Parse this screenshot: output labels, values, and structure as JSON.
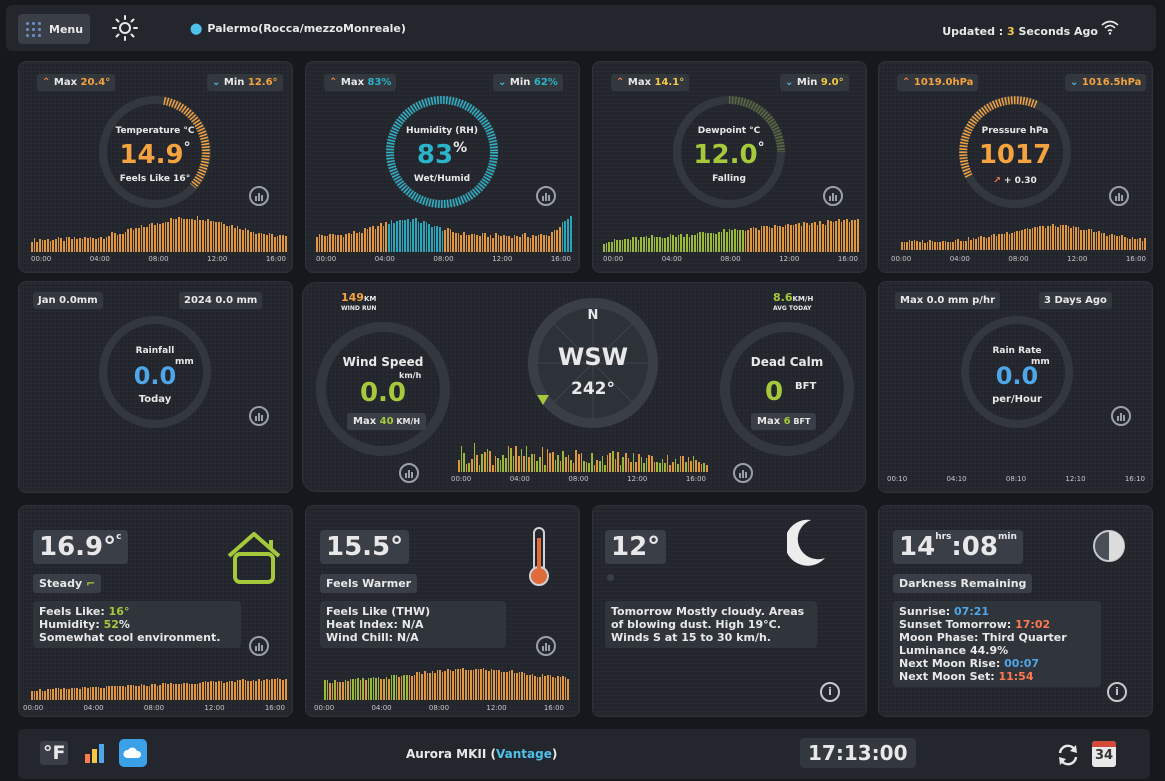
{
  "topbar": {
    "menu_label": "Menu",
    "location": "Palermo(Rocca/mezzoMonreale)",
    "updated_prefix": "Updated : ",
    "updated_count": "3",
    "updated_suffix": " Seconds Ago"
  },
  "temperature": {
    "max_label": "Max",
    "max_value": "20.4°",
    "min_label": "Min",
    "min_value": "12.6°",
    "title": "Temperature °C",
    "value": "14.9",
    "unit": "°",
    "sub": "Feels Like 16°",
    "ticks": [
      "00:00",
      "04:00",
      "08:00",
      "12:00",
      "16:00"
    ]
  },
  "humidity": {
    "max_label": "Max",
    "max_value": "83%",
    "min_label": "Min",
    "min_value": "62%",
    "title": "Humidity (RH)",
    "value": "83",
    "unit": "%",
    "sub": "Wet/Humid",
    "ticks": [
      "00:00",
      "04:00",
      "08:00",
      "12:00",
      "16:00"
    ]
  },
  "dewpoint": {
    "max_label": "Max",
    "max_value": "14.1°",
    "min_label": "Min",
    "min_value": "9.0°",
    "title": "Dewpoint °C",
    "value": "12.0",
    "unit": "°",
    "sub": "Falling",
    "ticks": [
      "00:00",
      "04:00",
      "08:00",
      "12:00",
      "16:00"
    ]
  },
  "pressure": {
    "max_value": "1019.0hPa",
    "min_value": "1016.5hPa",
    "title": "Pressure hPa",
    "value": "1017",
    "trend": "+ 0.30",
    "ticks": [
      "00:00",
      "04:00",
      "08:00",
      "12:00",
      "16:00"
    ]
  },
  "rainfall": {
    "month": "Jan 0.0mm",
    "year": "2024 0.0 mm",
    "title": "Rainfall",
    "unit": "mm",
    "value": "0.0",
    "sub": "Today"
  },
  "wind": {
    "run_value": "149",
    "run_unit": "KM",
    "run_label": "WIND RUN",
    "avg_value": "8.6",
    "avg_unit": "KM/H",
    "avg_label": "AVG TODAY",
    "speed_title": "Wind Speed",
    "speed_unit": "km/h",
    "speed_value": "0.0",
    "speed_max_prefix": "Max ",
    "speed_max_value": "40",
    "speed_max_unit": " KM/H",
    "compass_n": "N",
    "direction": "WSW",
    "degrees": "242°",
    "beaufort_title": "Dead Calm",
    "beaufort_value": "0",
    "beaufort_unit": "BFT",
    "bft_max_prefix": "Max ",
    "bft_max_value": "6",
    "bft_max_unit": " BFT",
    "ticks": [
      "00:00",
      "04:00",
      "08:00",
      "12:00",
      "16:00"
    ]
  },
  "rainrate": {
    "max": "Max 0.0 mm p/hr",
    "last": "3 Days Ago",
    "title": "Rain Rate",
    "unit": "mm",
    "value": "0.0",
    "sub": "per/Hour",
    "ticks": [
      "00:10",
      "04:10",
      "08:10",
      "12:10",
      "16:10"
    ]
  },
  "indoor": {
    "value": "16.9°",
    "unit": "c",
    "trend": "Steady",
    "feels_label": "Feels Like: ",
    "feels_value": "16°",
    "humidity_label": "Humidity: ",
    "humidity_value": "52",
    "humidity_unit": "%",
    "note": "Somewhat cool environment.",
    "ticks": [
      "00:00",
      "04:00",
      "08:00",
      "12:00",
      "16:00"
    ]
  },
  "feels": {
    "value": "15.5°",
    "trend": "Feels Warmer",
    "line1": "Feels Like (THW)",
    "line2": "Heat Index: N/A",
    "line3": "Wind Chill: N/A",
    "ticks": [
      "00:00",
      "04:00",
      "08:00",
      "12:00",
      "16:00"
    ]
  },
  "forecast": {
    "value": "12°",
    "text": "Tomorrow Mostly cloudy. Areas of blowing dust. High 19°C. Winds S at 15 to 30 km/h."
  },
  "moon": {
    "time_h": "14",
    "hrs": "hrs",
    "time_sep": ":",
    "time_m": "08",
    "min": "min",
    "label": "Darkness Remaining",
    "sunrise_label": "Sunrise: ",
    "sunrise": "07:21",
    "sunset_label": "Sunset Tomorrow: ",
    "sunset": "17:02",
    "phase": "Moon Phase: Third Quarter",
    "luminance": "Luminance 44.9%",
    "moonrise_label": "Next Moon Rise: ",
    "moonrise": "00:07",
    "moonset_label": "Next Moon Set: ",
    "moonset": "11:54"
  },
  "bottombar": {
    "units": "°F",
    "station_prefix": "Aurora MKII (",
    "station_name": "Vantage",
    "station_suffix": ")",
    "clock": "17:13:00",
    "calendar_day": "34"
  },
  "colors": {
    "orange": "#f4a340",
    "cyan": "#2bb3c9",
    "green": "#a6c93b",
    "blue": "#4fa6e8",
    "yellow": "#f4c744"
  }
}
